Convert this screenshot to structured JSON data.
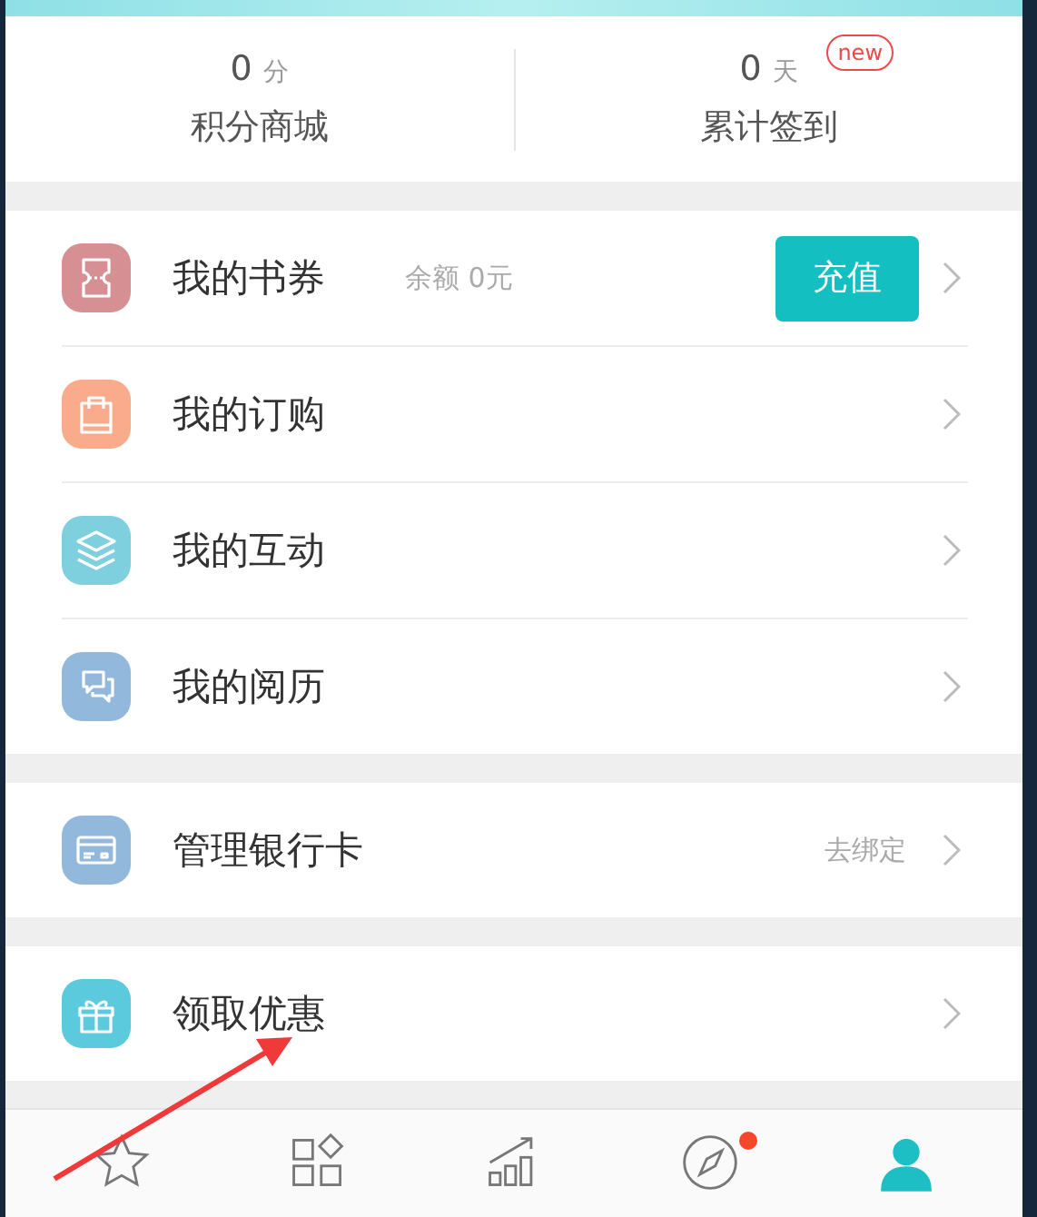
{
  "stats": [
    {
      "value": "0",
      "unit": "分",
      "label": "积分商城"
    },
    {
      "value": "0",
      "unit": "天",
      "label": "累计签到",
      "new_badge": "new"
    }
  ],
  "groups": [
    {
      "rows": [
        {
          "kind": "ticket",
          "color": "#d68f92",
          "label": "我的书券",
          "note": "余额 0元",
          "button": "充值"
        },
        {
          "kind": "bag",
          "color": "#f9ab8b",
          "label": "我的订购"
        },
        {
          "kind": "layers",
          "color": "#7fd0df",
          "label": "我的互动"
        },
        {
          "kind": "chat",
          "color": "#92b9dc",
          "label": "我的阅历"
        }
      ]
    },
    {
      "rows": [
        {
          "kind": "card",
          "color": "#92b9dc",
          "label": "管理银行卡",
          "side": "去绑定"
        }
      ]
    },
    {
      "rows": [
        {
          "kind": "gift",
          "color": "#5ccadd",
          "label": "领取优惠"
        }
      ]
    }
  ],
  "nav": [
    {
      "kind": "star",
      "selected": false,
      "dot": false
    },
    {
      "kind": "grid",
      "selected": false,
      "dot": false
    },
    {
      "kind": "bars",
      "selected": false,
      "dot": false
    },
    {
      "kind": "compass",
      "selected": false,
      "dot": true
    },
    {
      "kind": "person",
      "selected": true,
      "dot": false
    }
  ]
}
